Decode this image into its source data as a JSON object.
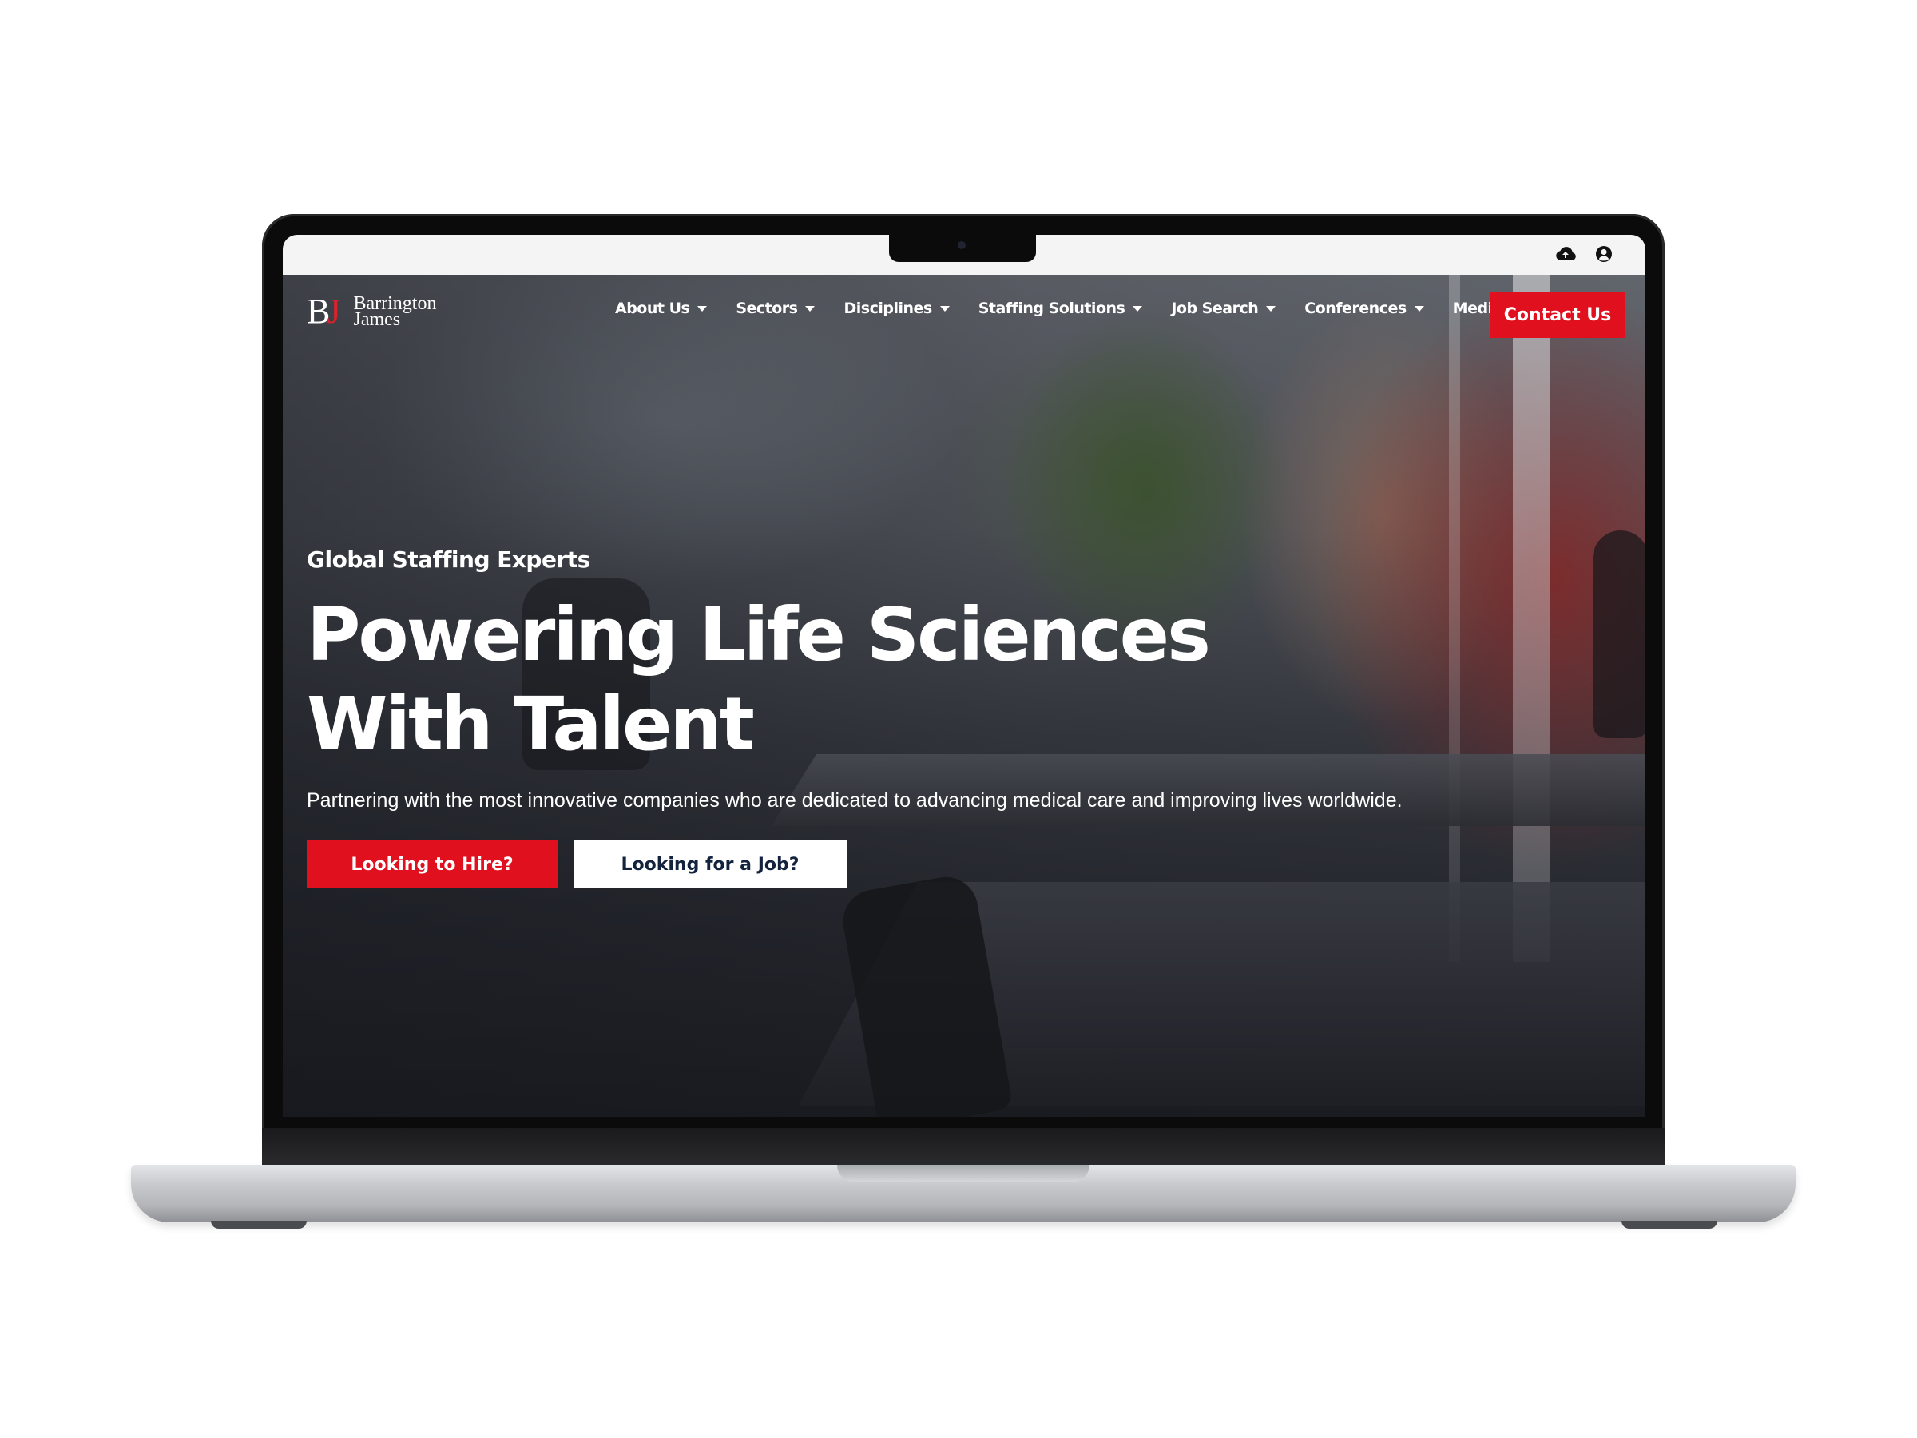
{
  "site": {
    "logo": {
      "mark_b": "B",
      "mark_j": "J",
      "line1": "Barrington",
      "line2": "James"
    },
    "nav": {
      "items": [
        {
          "label": "About Us",
          "icon": "caret-down-icon"
        },
        {
          "label": "Sectors",
          "icon": "caret-down-icon"
        },
        {
          "label": "Disciplines",
          "icon": "caret-down-icon"
        },
        {
          "label": "Staffing Solutions",
          "icon": "caret-down-icon"
        },
        {
          "label": "Job Search",
          "icon": "caret-down-icon"
        },
        {
          "label": "Conferences",
          "icon": "caret-down-icon"
        },
        {
          "label": "Media",
          "icon": "caret-down-icon"
        }
      ],
      "contact_label": "Contact Us"
    },
    "hero": {
      "eyebrow": "Global Staffing Experts",
      "headline_line1": "Powering Life Sciences",
      "headline_line2": "With Talent",
      "subtext": "Partnering with the most innovative companies who are dedicated to advancing medical care and improving lives worldwide.",
      "primary_cta": "Looking to Hire?",
      "secondary_cta": "Looking for a Job?"
    }
  },
  "menubar": {
    "icons": [
      "cloud-upload-icon",
      "user-account-icon"
    ]
  },
  "colors": {
    "accent_red": "#e0101f",
    "navy": "#14233d",
    "white": "#ffffff"
  }
}
